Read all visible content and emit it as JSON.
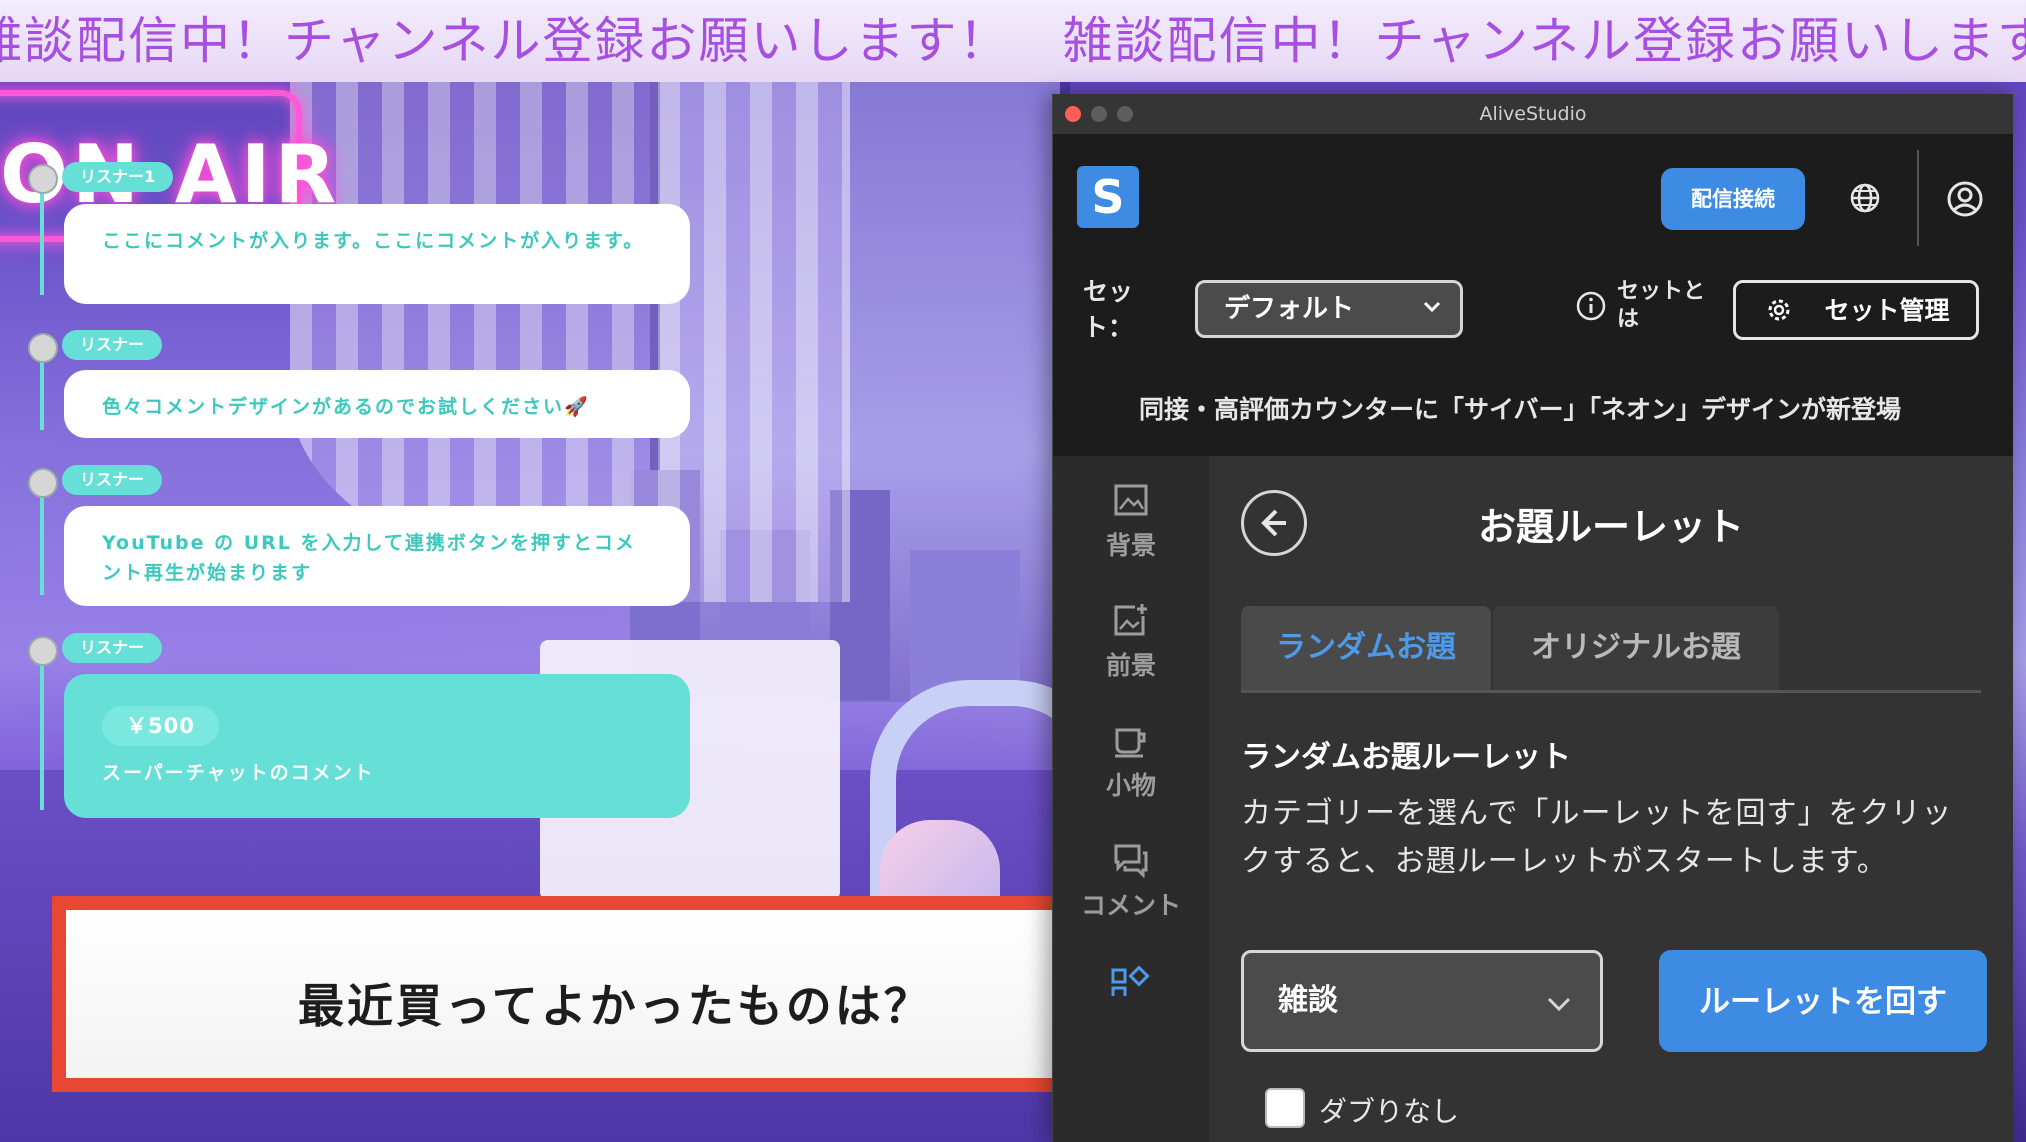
{
  "stream": {
    "ticker_text": "雑談配信中！チャンネル登録お願いします！　雑談配信中！チャンネル登録お願いします！",
    "neon_sign": "ON AIR",
    "comments": [
      {
        "user": "リスナー1",
        "text": "ここにコメントが入ります。ここにコメントが入ります。"
      },
      {
        "user": "リスナー",
        "text": "色々コメントデザインがあるのでお試しください🚀"
      },
      {
        "user": "リスナー",
        "text": "YouTube の URL を入力して連携ボタンを押すとコメント再生が始まります"
      },
      {
        "user": "リスナー",
        "price": "￥500",
        "text": "スーパーチャットのコメント"
      }
    ],
    "topic": "最近買ってよかったものは？"
  },
  "app": {
    "window_title": "AliveStudio",
    "logo_letter": "S",
    "connect_label": "配信接続",
    "set_label": "セット：",
    "set_selected": "デフォルト",
    "set_info_label": "セットとは",
    "set_manage_label": "セット管理",
    "news": "同接・高評価カウンターに「サイバー」「ネオン」デザインが新登場",
    "sidebar": [
      {
        "label": "背景",
        "icon": "image-icon"
      },
      {
        "label": "前景",
        "icon": "add-image-icon"
      },
      {
        "label": "小物",
        "icon": "cup-icon"
      },
      {
        "label": "コメント",
        "icon": "chat-icon"
      }
    ],
    "panel": {
      "title": "お題ルーレット",
      "tabs": [
        "ランダムお題",
        "オリジナルお題"
      ],
      "section_title": "ランダムお題ルーレット",
      "description": "カテゴリーを選んで「ルーレットを回す」をクリックすると、お題ルーレットがスタートします。",
      "category_selected": "雑談",
      "spin_label": "ルーレットを回す",
      "no_duplicate_label": "ダブりなし"
    },
    "colors": {
      "accent": "#3d8be3",
      "comment": "#66e0d6",
      "topic_border": "#e64833",
      "ticker": "#a64fe0"
    }
  }
}
